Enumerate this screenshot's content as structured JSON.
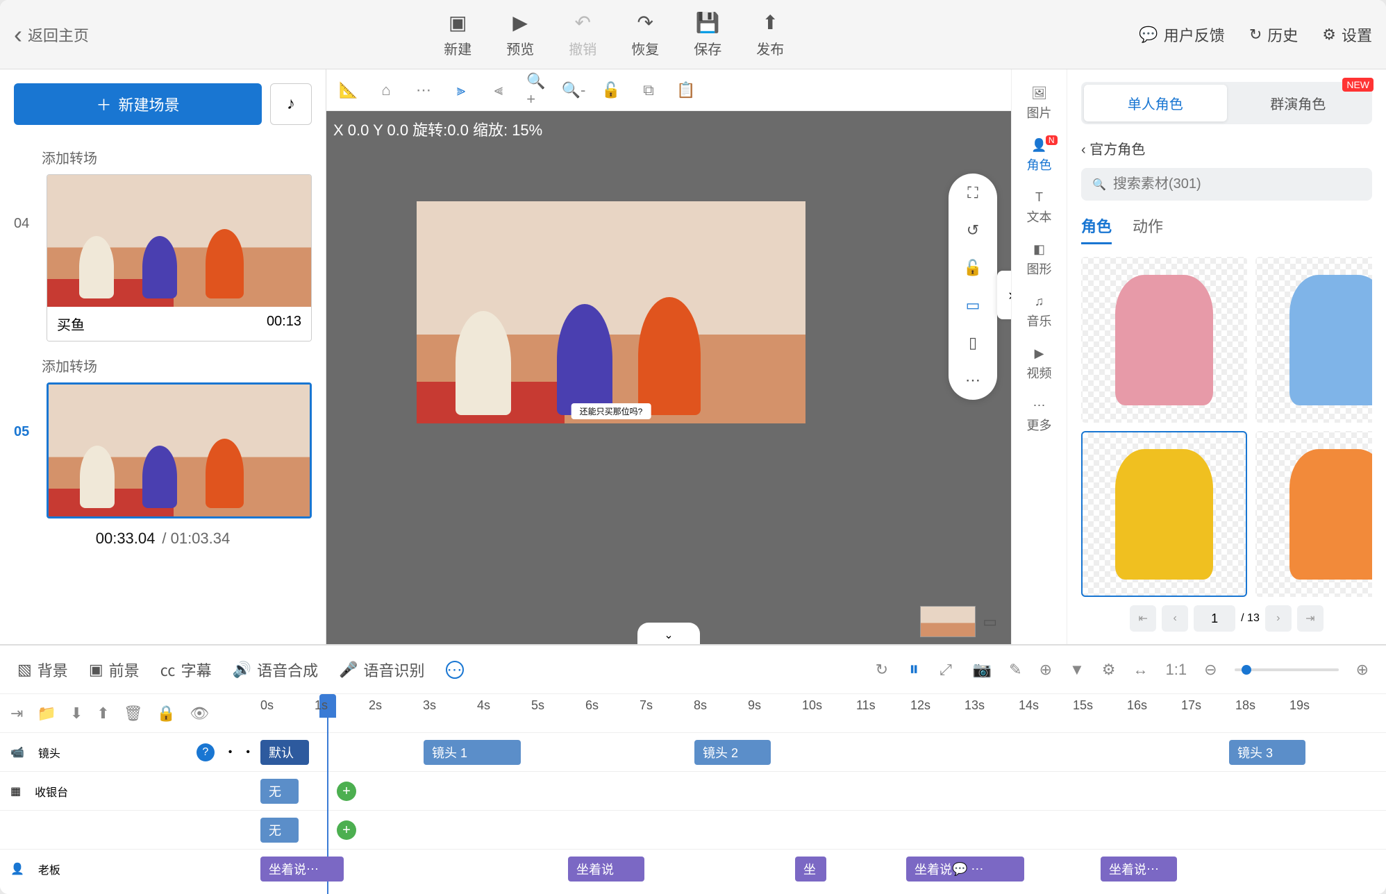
{
  "topbar": {
    "back": "返回主页",
    "actions": {
      "new": "新建",
      "preview": "预览",
      "undo": "撤销",
      "redo": "恢复",
      "save": "保存",
      "publish": "发布"
    },
    "right": {
      "feedback": "用户反馈",
      "history": "历史",
      "settings": "设置"
    }
  },
  "scene_panel": {
    "new_scene": "新建场景",
    "add_transition": "添加转场",
    "scenes": [
      {
        "num": "04",
        "title": "买鱼",
        "duration": "00:13",
        "active": false
      },
      {
        "num": "05",
        "title": "",
        "duration": "",
        "active": true
      }
    ],
    "time_current": "00:33.04",
    "time_total": "/ 01:03.34"
  },
  "canvas": {
    "info": "X 0.0 Y 0.0 旋转:0.0 缩放: 15%",
    "dialogue": "还能只买那位吗?"
  },
  "asset_nav": {
    "items": [
      {
        "key": "image",
        "label": "图片"
      },
      {
        "key": "role",
        "label": "角色",
        "badge": "N",
        "active": true
      },
      {
        "key": "text",
        "label": "文本"
      },
      {
        "key": "shape",
        "label": "图形"
      },
      {
        "key": "music",
        "label": "音乐"
      },
      {
        "key": "video",
        "label": "视频"
      },
      {
        "key": "more",
        "label": "更多"
      }
    ]
  },
  "asset_panel": {
    "tabs": {
      "single": "单人角色",
      "group": "群演角色",
      "badge": "NEW"
    },
    "breadcrumb": "官方角色",
    "search_placeholder": "搜索素材(301)",
    "subtabs": {
      "role": "角色",
      "action": "动作"
    },
    "pager": {
      "current": "1",
      "total": "/ 13"
    },
    "asset_colors": [
      "#e79aa8",
      "#7fb4e8",
      "#303030",
      "#f0c020",
      "#f28a3a",
      "#8fc9e8"
    ]
  },
  "timeline": {
    "toolbar": {
      "bg": "背景",
      "fg": "前景",
      "sub": "字幕",
      "tts": "语音合成",
      "asr": "语音识别"
    },
    "ticks": [
      "0s",
      "1s",
      "2s",
      "3s",
      "4s",
      "5s",
      "6s",
      "7s",
      "8s",
      "9s",
      "10s",
      "11s",
      "12s",
      "13s",
      "14s",
      "15s",
      "16s",
      "17s",
      "18s",
      "19s"
    ],
    "rows": {
      "camera": "镜头",
      "counter": "收银台",
      "boss": "老板"
    },
    "clips": {
      "default": "默认",
      "cam1": "镜头 1",
      "cam2": "镜头 2",
      "cam3": "镜头 3",
      "none": "无",
      "sit_talk": "坐着说",
      "sit": "坐"
    }
  }
}
